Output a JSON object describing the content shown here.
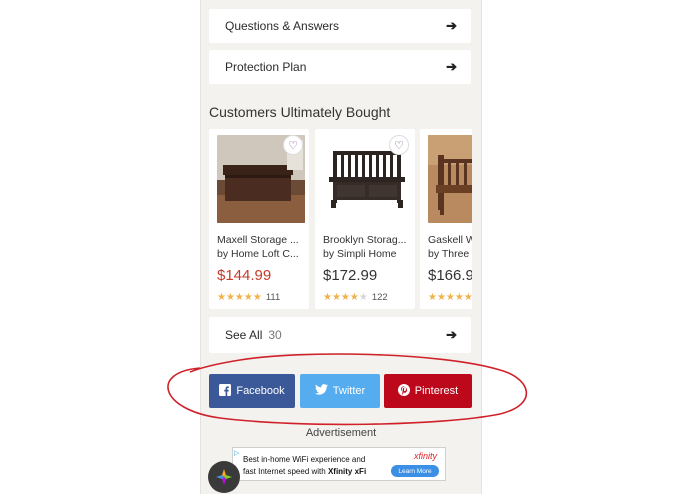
{
  "rows": {
    "questions_label": "Questions & Answers",
    "protection_label": "Protection Plan"
  },
  "section_title": "Customers Ultimately Bought",
  "products": [
    {
      "name": "Maxell Storage ...",
      "brand": "by Home Loft C...",
      "price": "$144.99",
      "rating": 5,
      "reviews": "111",
      "on_sale": true
    },
    {
      "name": "Brooklyn Storag...",
      "brand": "by Simpli Home",
      "price": "$172.99",
      "rating": 4,
      "reviews": "122",
      "on_sale": false
    },
    {
      "name": "Gaskell W",
      "brand": "by Three",
      "price": "$166.9",
      "rating": 5,
      "reviews": "",
      "on_sale": false
    }
  ],
  "see_all": {
    "label": "See All",
    "count": "30"
  },
  "share": {
    "facebook": "Facebook",
    "twitter": "Twitter",
    "pinterest": "Pinterest"
  },
  "advertisement_label": "Advertisement",
  "ad": {
    "line1": "Best in-home WiFi experience and",
    "line2_prefix": "fast Internet speed with ",
    "line2_bold": "Xfinity xFi",
    "brand": "xfinity",
    "cta": "Learn More"
  },
  "colors": {
    "facebook": "#3b5998",
    "twitter": "#55acee",
    "pinterest": "#bd081c",
    "sale_price": "#c43b2a",
    "star": "#f0b24a",
    "annotation": "#d0212a"
  },
  "icons": {
    "row_arrow": "arrow-right-icon",
    "wishlist": "heart-icon",
    "facebook": "facebook-icon",
    "twitter": "twitter-bird-icon",
    "pinterest": "pinterest-icon",
    "fab": "app-logo-icon"
  }
}
